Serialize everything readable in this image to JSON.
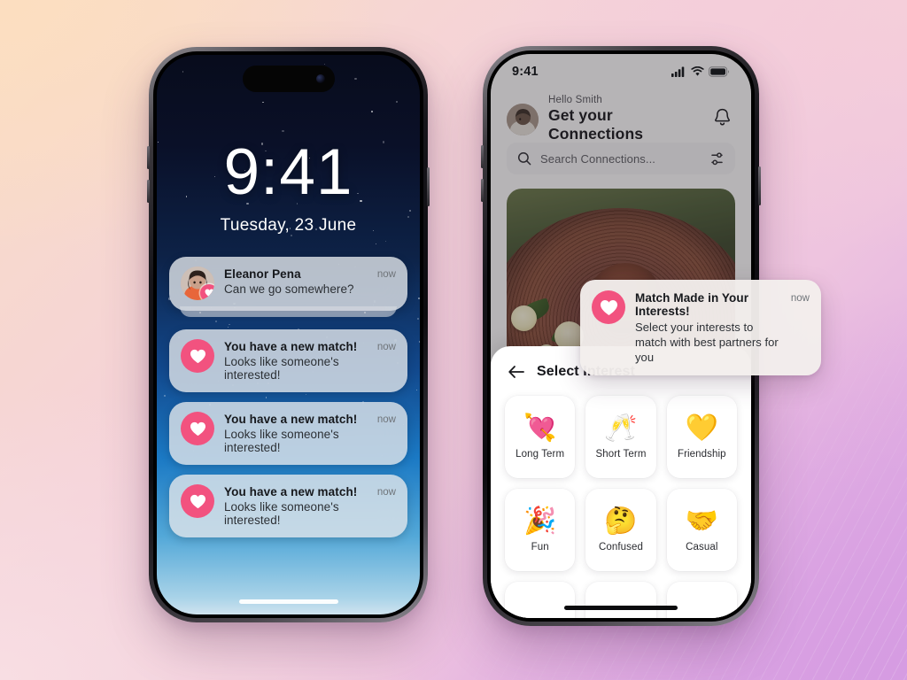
{
  "background": {
    "colors": [
      "#fcdec0",
      "#f5ced a",
      "#f8dee3",
      "#d69ce2"
    ]
  },
  "lock_screen": {
    "time": "9:41",
    "date": "Tuesday,  23 June",
    "notifications": [
      {
        "type": "message",
        "icon": "avatar-photo",
        "title": "Eleanor Pena",
        "subtitle": "Can we go somewhere?",
        "time": "now",
        "stacked": true
      },
      {
        "type": "match",
        "icon": "heart-icon",
        "title": "You have a new match!",
        "subtitle": "Looks like someone's interested!",
        "time": "now",
        "stacked": false
      },
      {
        "type": "match",
        "icon": "heart-icon",
        "title": "You have a new match!",
        "subtitle": "Looks like someone's interested!",
        "time": "now",
        "stacked": false
      },
      {
        "type": "match",
        "icon": "heart-icon",
        "title": "You have a new match!",
        "subtitle": "Looks like someone's interested!",
        "time": "now",
        "stacked": false
      }
    ]
  },
  "app_screen": {
    "status_bar": {
      "time": "9:41",
      "icons": [
        "cellular-signal-icon",
        "wifi-icon",
        "battery-icon"
      ]
    },
    "header": {
      "greeting": "Hello Smith",
      "title": "Get your Connections",
      "avatar": "user-avatar",
      "bell_icon": "bell-icon"
    },
    "search": {
      "placeholder": "Search Connections...",
      "search_icon": "search-icon",
      "filter_icon": "filter-sliders-icon"
    },
    "photo_card": {
      "alt": "woman wearing brown straw hat with flowers"
    },
    "toast": {
      "icon": "heart-icon",
      "title": "Match Made in Your Interests!",
      "subtitle": "Select your interests to match with best partners for you",
      "time": "now",
      "accent": "#f2527f"
    },
    "sheet": {
      "back_icon": "arrow-left-icon",
      "title": "Select Interest",
      "interests": [
        {
          "emoji": "💘",
          "label": "Long Term"
        },
        {
          "emoji": "🥂",
          "label": "Short Term"
        },
        {
          "emoji": "💛",
          "label": "Friendship"
        },
        {
          "emoji": "🎉",
          "label": "Fun"
        },
        {
          "emoji": "🤔",
          "label": "Confused"
        },
        {
          "emoji": "🤝",
          "label": "Casual"
        },
        {
          "emoji": "",
          "label": ""
        },
        {
          "emoji": "",
          "label": ""
        },
        {
          "emoji": "",
          "label": ""
        }
      ]
    }
  }
}
